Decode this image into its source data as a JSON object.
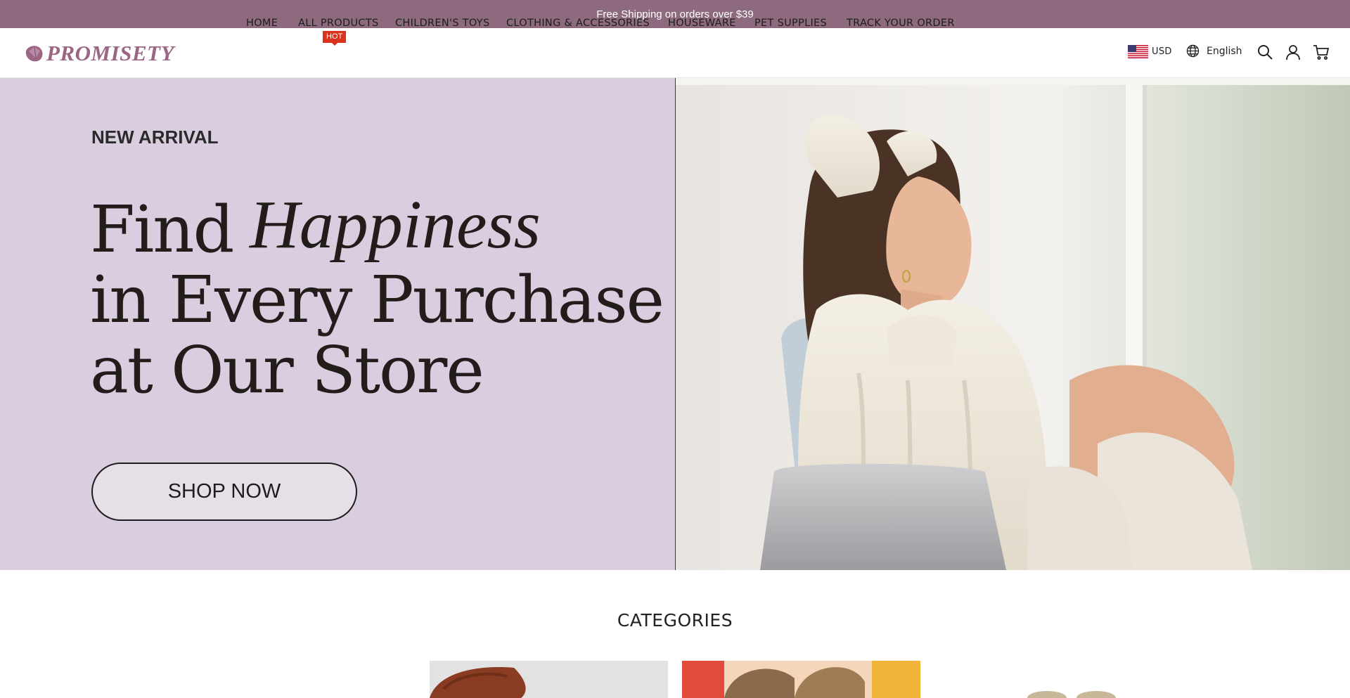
{
  "announcement": {
    "text": "Free Shipping on orders over $39"
  },
  "brand": {
    "name": "PROMISETY"
  },
  "nav": {
    "items": [
      {
        "label": "HOME"
      },
      {
        "label": "ALL PRODUCTS",
        "badge": "HOT"
      },
      {
        "label": "CHILDREN'S TOYS"
      },
      {
        "label": "CLOTHING & ACCESSORIES"
      },
      {
        "label": "HOUSEWARE"
      },
      {
        "label": "PET SUPPLIES"
      },
      {
        "label": "TRACK YOUR ORDER"
      }
    ]
  },
  "header": {
    "currency": "USD",
    "language": "English",
    "icons": [
      "us-flag-icon",
      "globe-icon",
      "search-icon",
      "account-icon",
      "cart-icon"
    ]
  },
  "hero": {
    "eyebrow": "NEW ARRIVAL",
    "line1": "Find",
    "script_word": "Happiness",
    "line2": "in Every Purchase",
    "line3": "at Our Store",
    "cta": "SHOP NOW"
  },
  "categories": {
    "title": "CATEGORIES"
  },
  "colors": {
    "announcement_bg": "#8d6a7d",
    "brand": "#9b6683",
    "hero_bg": "#dacde0",
    "hot_badge": "#d9331d"
  }
}
